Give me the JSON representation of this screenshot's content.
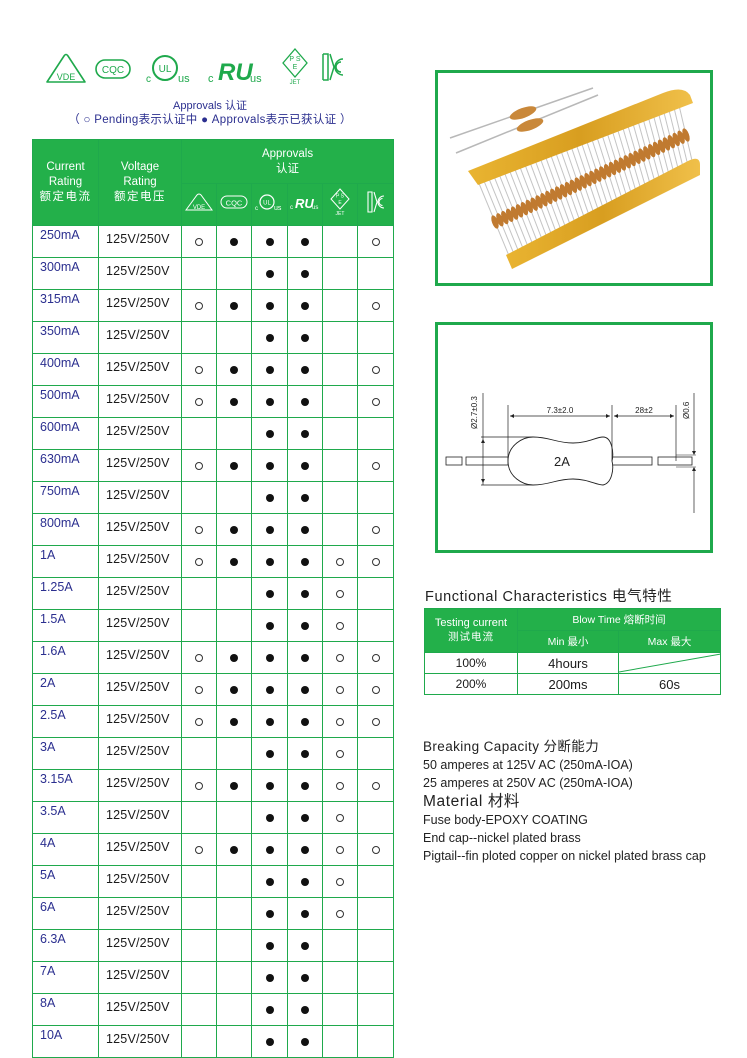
{
  "certification_logos": [
    {
      "name": "vde-icon",
      "text": "VDE"
    },
    {
      "name": "cqc-icon",
      "text": "CQC"
    },
    {
      "name": "cul-us-icon",
      "text": "UL",
      "prefix": "c",
      "suffix": "us"
    },
    {
      "name": "cru-us-icon",
      "text": "RU",
      "prefix": "c",
      "suffix": "us"
    },
    {
      "name": "pse-jet-icon",
      "text": "PSE",
      "sub": "JET"
    },
    {
      "name": "kc-icon",
      "text": "KC"
    }
  ],
  "approvals_note": {
    "line1": "Approvals  认证",
    "line2": "（ ○ Pending表示认证中 ● Approvals表示已获认证 ）"
  },
  "main_table": {
    "headers": {
      "current": [
        "Current",
        "Rating",
        "额定电流"
      ],
      "voltage": [
        "Voltage",
        "Rating",
        "额定电压"
      ],
      "approvals": [
        "Approvals",
        "认证"
      ],
      "approval_columns": [
        "VDE",
        "CQC",
        "cULus",
        "cRUus",
        "PSE JET",
        "KC"
      ]
    },
    "legend": {
      "full": "approved",
      "open": "pending",
      "empty": "none"
    },
    "rows": [
      {
        "current": "250mA",
        "voltage": "125V/250V",
        "marks": [
          "open",
          "full",
          "full",
          "full",
          "",
          "open"
        ]
      },
      {
        "current": "300mA",
        "voltage": "125V/250V",
        "marks": [
          "",
          "",
          "full",
          "full",
          "",
          ""
        ]
      },
      {
        "current": "315mA",
        "voltage": "125V/250V",
        "marks": [
          "open",
          "full",
          "full",
          "full",
          "",
          "open"
        ]
      },
      {
        "current": "350mA",
        "voltage": "125V/250V",
        "marks": [
          "",
          "",
          "full",
          "full",
          "",
          ""
        ]
      },
      {
        "current": "400mA",
        "voltage": "125V/250V",
        "marks": [
          "open",
          "full",
          "full",
          "full",
          "",
          "open"
        ]
      },
      {
        "current": "500mA",
        "voltage": "125V/250V",
        "marks": [
          "open",
          "full",
          "full",
          "full",
          "",
          "open"
        ]
      },
      {
        "current": "600mA",
        "voltage": "125V/250V",
        "marks": [
          "",
          "",
          "full",
          "full",
          "",
          ""
        ]
      },
      {
        "current": "630mA",
        "voltage": "125V/250V",
        "marks": [
          "open",
          "full",
          "full",
          "full",
          "",
          "open"
        ]
      },
      {
        "current": "750mA",
        "voltage": "125V/250V",
        "marks": [
          "",
          "",
          "full",
          "full",
          "",
          ""
        ]
      },
      {
        "current": "800mA",
        "voltage": "125V/250V",
        "marks": [
          "open",
          "full",
          "full",
          "full",
          "",
          "open"
        ]
      },
      {
        "current": "1A",
        "voltage": "125V/250V",
        "marks": [
          "open",
          "full",
          "full",
          "full",
          "open",
          "open"
        ]
      },
      {
        "current": "1.25A",
        "voltage": "125V/250V",
        "marks": [
          "",
          "",
          "full",
          "full",
          "open",
          ""
        ]
      },
      {
        "current": "1.5A",
        "voltage": "125V/250V",
        "marks": [
          "",
          "",
          "full",
          "full",
          "open",
          ""
        ]
      },
      {
        "current": "1.6A",
        "voltage": "125V/250V",
        "marks": [
          "open",
          "full",
          "full",
          "full",
          "open",
          "open"
        ]
      },
      {
        "current": "2A",
        "voltage": "125V/250V",
        "marks": [
          "open",
          "full",
          "full",
          "full",
          "open",
          "open"
        ]
      },
      {
        "current": "2.5A",
        "voltage": "125V/250V",
        "marks": [
          "open",
          "full",
          "full",
          "full",
          "open",
          "open"
        ]
      },
      {
        "current": "3A",
        "voltage": "125V/250V",
        "marks": [
          "",
          "",
          "full",
          "full",
          "open",
          ""
        ]
      },
      {
        "current": "3.15A",
        "voltage": "125V/250V",
        "marks": [
          "open",
          "full",
          "full",
          "full",
          "open",
          "open"
        ]
      },
      {
        "current": "3.5A",
        "voltage": "125V/250V",
        "marks": [
          "",
          "",
          "full",
          "full",
          "open",
          ""
        ]
      },
      {
        "current": "4A",
        "voltage": "125V/250V",
        "marks": [
          "open",
          "full",
          "full",
          "full",
          "open",
          "open"
        ]
      },
      {
        "current": "5A",
        "voltage": "125V/250V",
        "marks": [
          "",
          "",
          "full",
          "full",
          "open",
          ""
        ]
      },
      {
        "current": "6A",
        "voltage": "125V/250V",
        "marks": [
          "",
          "",
          "full",
          "full",
          "open",
          ""
        ]
      },
      {
        "current": "6.3A",
        "voltage": "125V/250V",
        "marks": [
          "",
          "",
          "full",
          "full",
          "",
          ""
        ]
      },
      {
        "current": "7A",
        "voltage": "125V/250V",
        "marks": [
          "",
          "",
          "full",
          "full",
          "",
          ""
        ]
      },
      {
        "current": "8A",
        "voltage": "125V/250V",
        "marks": [
          "",
          "",
          "full",
          "full",
          "",
          ""
        ]
      },
      {
        "current": "10A",
        "voltage": "125V/250V",
        "marks": [
          "",
          "",
          "full",
          "full",
          "",
          ""
        ]
      }
    ]
  },
  "product_photo": {
    "alt": "Axial epoxy-coated fuses on tape reel"
  },
  "dimension_drawing": {
    "body_diameter": "Ø2.7±0.3",
    "body_length": "7.3±2.0",
    "lead_length": "28±2",
    "lead_diameter": "Ø0.6",
    "body_label": "2A"
  },
  "functional_characteristics": {
    "title": "Functional  Characteristics  电气特性",
    "headers": {
      "testing_current": [
        "Testing current",
        "测试电流"
      ],
      "blow_time": "Blow Time 熔断时间",
      "min": "Min 最小",
      "max": "Max 最大"
    },
    "rows": [
      {
        "current": "100%",
        "min": "4hours",
        "max": ""
      },
      {
        "current": "200%",
        "min": "200ms",
        "max": "60s"
      }
    ]
  },
  "breaking_capacity": {
    "title": "Breaking  Capacity  分断能力",
    "lines": [
      "50 amperes at 125V AC (250mA-IOA)",
      "25 amperes at 250V AC (250mA-IOA)"
    ]
  },
  "material": {
    "title": "Material   材料",
    "lines": [
      "Fuse body-EPOXY COATING",
      "End cap--nickel plated brass",
      "Pigtail--fin ploted copper on nickel plated brass cap"
    ]
  },
  "colors": {
    "brand_green": "#23b04a",
    "text_blue": "#2b2f8f"
  }
}
